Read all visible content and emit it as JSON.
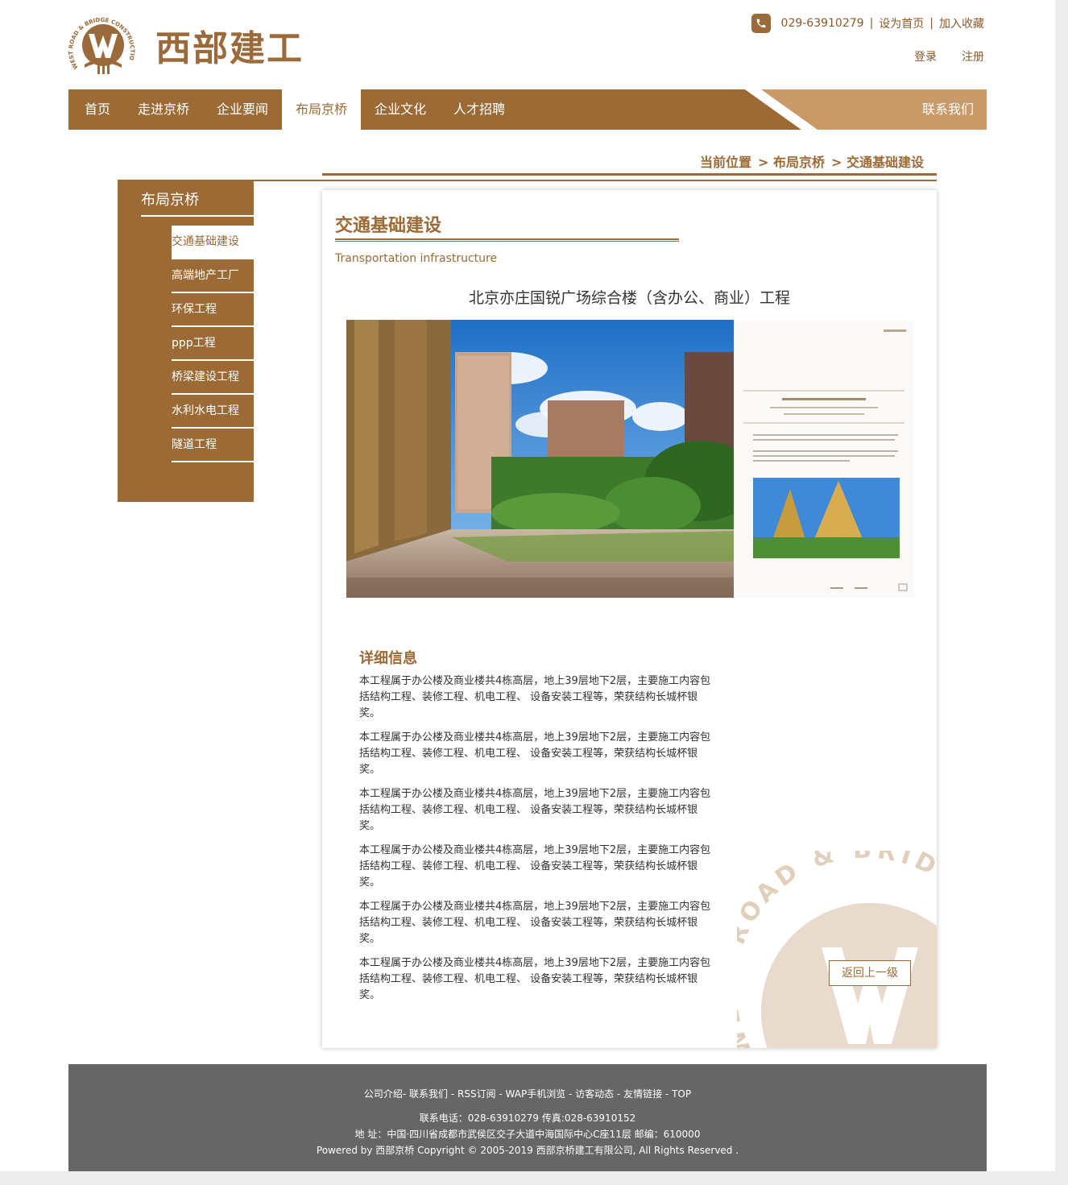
{
  "header": {
    "logo_text": "西部建工",
    "logo_ring_text": "WEST ROAD & BRIDGE CONSTRUCTION",
    "phone": "029-63910279",
    "set_homepage": "设为首页",
    "add_favorite": "加入收藏",
    "separator": "|",
    "login": "登录",
    "register": "注册"
  },
  "nav": {
    "items": [
      {
        "label": "首页"
      },
      {
        "label": "走进京桥"
      },
      {
        "label": "企业要闻"
      },
      {
        "label": "布局京桥"
      },
      {
        "label": "企业文化"
      },
      {
        "label": "人才招聘"
      }
    ],
    "active": "布局京桥",
    "contact": "联系我们"
  },
  "breadcrumb": {
    "items": [
      "当前位置",
      "> 布局京桥",
      "> 交通基础建设"
    ]
  },
  "sidebar": {
    "title": "布局京桥",
    "items": [
      {
        "label": "交通基础建设"
      },
      {
        "label": "高端地产工厂"
      },
      {
        "label": "环保工程"
      },
      {
        "label": "ppp工程"
      },
      {
        "label": "桥梁建设工程"
      },
      {
        "label": "水利水电工程"
      },
      {
        "label": "隧道工程"
      }
    ],
    "active": "交通基础建设"
  },
  "content": {
    "title": "交通基础建设",
    "subtitle": "Transportation infrastructure",
    "project_title": "北京亦庄国锐广场综合楼（含办公、商业）工程",
    "detail_title": "详细信息",
    "paragraphs": [
      "本工程属于办公楼及商业楼共4栋高层，地上39层地下2层，主要施工内容包括结构工程、装修工程、机电工程、 设备安装工程等，荣获结构长城杯银奖。",
      "本工程属于办公楼及商业楼共4栋高层，地上39层地下2层，主要施工内容包括结构工程、装修工程、机电工程、 设备安装工程等，荣获结构长城杯银奖。",
      "本工程属于办公楼及商业楼共4栋高层，地上39层地下2层，主要施工内容包括结构工程、装修工程、机电工程、 设备安装工程等，荣获结构长城杯银奖。",
      "本工程属于办公楼及商业楼共4栋高层，地上39层地下2层，主要施工内容包括结构工程、装修工程、机电工程、 设备安装工程等，荣获结构长城杯银奖。",
      "本工程属于办公楼及商业楼共4栋高层，地上39层地下2层，主要施工内容包括结构工程、装修工程、机电工程、 设备安装工程等，荣获结构长城杯银奖。",
      "本工程属于办公楼及商业楼共4栋高层，地上39层地下2层，主要施工内容包括结构工程、装修工程、机电工程、 设备安装工程等，荣获结构长城杯银奖。"
    ],
    "watermark_text": "WEST ROAD & BRIDGE C",
    "back_button": "返回上一级"
  },
  "footer": {
    "links": "公司介绍- 联系我们 - RSS订阅 - WAP手机浏览 - 访客动态 - 友情链接 - TOP",
    "contact": "联系电话：028-63910279 传真:028-63910152",
    "address": "地 址：中国·四川省成都市武侯区交子大道中海国际中心C座11层 邮编：610000",
    "copyright": "Powered by 西部京桥 Copyright © 2005-2019 西部京桥建工有限公司, All Rights Reserved ."
  },
  "colors": {
    "brand": "#9b6a35",
    "brand_light": "#c99a68",
    "footer_bg": "#666666"
  },
  "icons": {
    "phone": "phone-icon",
    "logo": "logo-emblem"
  }
}
